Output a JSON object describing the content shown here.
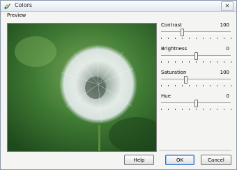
{
  "window": {
    "title": "Colors",
    "close_glyph": "✕"
  },
  "preview": {
    "label": "Preview",
    "image_name": "dandelion-seed-head"
  },
  "controls": [
    {
      "label": "Contrast",
      "value": "100",
      "level_percent": 30
    },
    {
      "label": "Brightness",
      "value": "0",
      "level_percent": 50
    },
    {
      "label": "Saturation",
      "value": "100",
      "level_percent": 35
    },
    {
      "label": "Hue",
      "value": "0",
      "level_percent": 50
    }
  ],
  "buttons": {
    "help": "Help",
    "ok": "OK",
    "cancel": "Cancel"
  },
  "colors": {
    "accent": "#2b6ec4",
    "window_bg": "#f4f4f2",
    "border": "#8a97a8"
  }
}
